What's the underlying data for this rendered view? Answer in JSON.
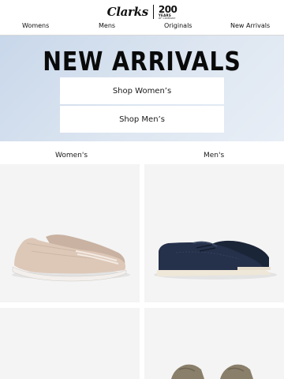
{
  "brand": {
    "logo_text": "Clarks",
    "anniversary_number": "200",
    "anniversary_sub": "YEARS",
    "anniversary_sub2": "OF COMPANY"
  },
  "nav": {
    "items": [
      "Womens",
      "Mens",
      "Originals",
      "New Arrivals"
    ]
  },
  "hero": {
    "title": "NEW ARRIVALS",
    "buttons": [
      "Shop Women’s",
      "Shop Men’s"
    ],
    "background_color": "#d4e0ee"
  },
  "categories": {
    "women_label": "Women's",
    "men_label": "Men's"
  },
  "products": [
    {
      "name": "womens-slip-on-flat",
      "color": "#d9c3b3",
      "icon": "womens-shoe-image"
    },
    {
      "name": "mens-boat-shoe",
      "color": "#1e2a40",
      "icon": "mens-shoe-image"
    },
    {
      "name": "womens-product",
      "color": "#f4f4f4",
      "icon": "product-image"
    },
    {
      "name": "mens-product",
      "color": "#8a7f6a",
      "icon": "product-image"
    }
  ]
}
